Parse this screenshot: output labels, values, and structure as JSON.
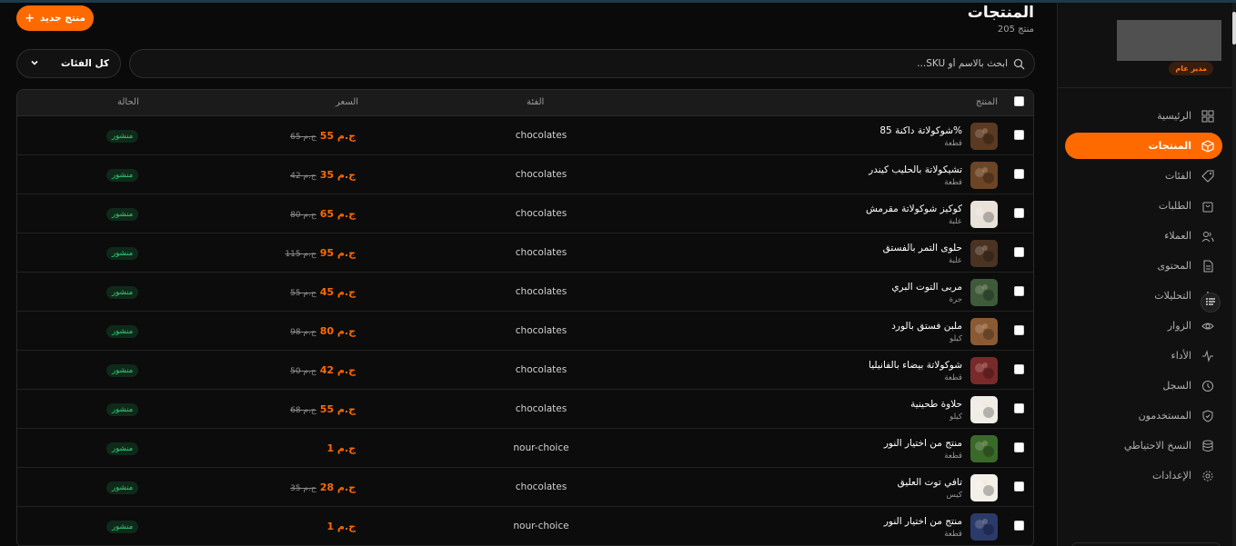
{
  "header": {
    "title": "المنتجات",
    "count": "205 منتج",
    "new_button": "منتج جديد"
  },
  "filters": {
    "search_placeholder": "ابحث بالاسم أو SKU...",
    "category_select": "كل الفئات"
  },
  "sidebar": {
    "role_badge": "مدير عام",
    "items": [
      {
        "label": "الرئيسية",
        "icon": "grid-icon"
      },
      {
        "label": "المنتجات",
        "icon": "box-icon",
        "active": true
      },
      {
        "label": "الفئات",
        "icon": "tag-icon"
      },
      {
        "label": "الطلبات",
        "icon": "shopping-bag-icon"
      },
      {
        "label": "العملاء",
        "icon": "users-icon"
      },
      {
        "label": "المحتوى",
        "icon": "file-text-icon"
      },
      {
        "label": "التحليلات",
        "icon": "bar-chart-icon"
      },
      {
        "label": "الزوار",
        "icon": "eye-icon"
      },
      {
        "label": "الأداء",
        "icon": "activity-icon"
      },
      {
        "label": "السجل",
        "icon": "history-icon"
      },
      {
        "label": "المستخدمون",
        "icon": "shield-icon"
      },
      {
        "label": "النسخ الاحتياطي",
        "icon": "database-icon"
      },
      {
        "label": "الإعدادات",
        "icon": "gear-icon"
      }
    ]
  },
  "table": {
    "columns": {
      "product": "المنتج",
      "category": "الفئة",
      "price": "السعر",
      "status": "الحالة"
    },
    "rows": [
      {
        "name": "شوكولاتة داكنة 85%",
        "unit": "قطعة",
        "category": "chocolates",
        "price": "55 ج.م",
        "old_price": "65 ج.م",
        "status": "منشور",
        "thumb": "#5a3a22"
      },
      {
        "name": "تشيكولاتة بالحليب كيندر",
        "unit": "قطعة",
        "category": "chocolates",
        "price": "35 ج.م",
        "old_price": "42 ج.م",
        "status": "منشور",
        "thumb": "#6b4526"
      },
      {
        "name": "كوكيز شوكولاتة مقرمش",
        "unit": "علبة",
        "category": "chocolates",
        "price": "65 ج.م",
        "old_price": "80 ج.م",
        "status": "منشور",
        "thumb": "#e8e2d8"
      },
      {
        "name": "حلوى التمر بالفستق",
        "unit": "علبة",
        "category": "chocolates",
        "price": "95 ج.م",
        "old_price": "115 ج.م",
        "status": "منشور",
        "thumb": "#4a3322"
      },
      {
        "name": "مربى التوت البري",
        "unit": "جرة",
        "category": "chocolates",
        "price": "45 ج.م",
        "old_price": "55 ج.م",
        "status": "منشور",
        "thumb": "#3e5a3a"
      },
      {
        "name": "ملبن فستق بالورد",
        "unit": "كيلو",
        "category": "chocolates",
        "price": "80 ج.م",
        "old_price": "98 ج.م",
        "status": "منشور",
        "thumb": "#8a5a34"
      },
      {
        "name": "شوكولاتة بيضاء بالفانيليا",
        "unit": "قطعة",
        "category": "chocolates",
        "price": "42 ج.م",
        "old_price": "50 ج.م",
        "status": "منشور",
        "thumb": "#7a2a2a"
      },
      {
        "name": "حلاوة طحينية",
        "unit": "كيلو",
        "category": "chocolates",
        "price": "55 ج.م",
        "old_price": "68 ج.م",
        "status": "منشور",
        "thumb": "#f0ece6"
      },
      {
        "name": "منتج من اختيار النور",
        "unit": "قطعة",
        "category": "nour-choice",
        "price": "1 ج.م",
        "old_price": "",
        "status": "منشور",
        "thumb": "#3a6a2a"
      },
      {
        "name": "تافي توت العليق",
        "unit": "كيس",
        "category": "chocolates",
        "price": "28 ج.م",
        "old_price": "35 ج.م",
        "status": "منشور",
        "thumb": "#f3efe9"
      },
      {
        "name": "منتج من اختيار النور",
        "unit": "قطعة",
        "category": "nour-choice",
        "price": "1 ج.م",
        "old_price": "",
        "status": "منشور",
        "thumb": "#2a3a6a"
      }
    ]
  },
  "colors": {
    "accent": "#ff6a00",
    "status_green": "#36d07a",
    "background": "#0a0a0a"
  }
}
